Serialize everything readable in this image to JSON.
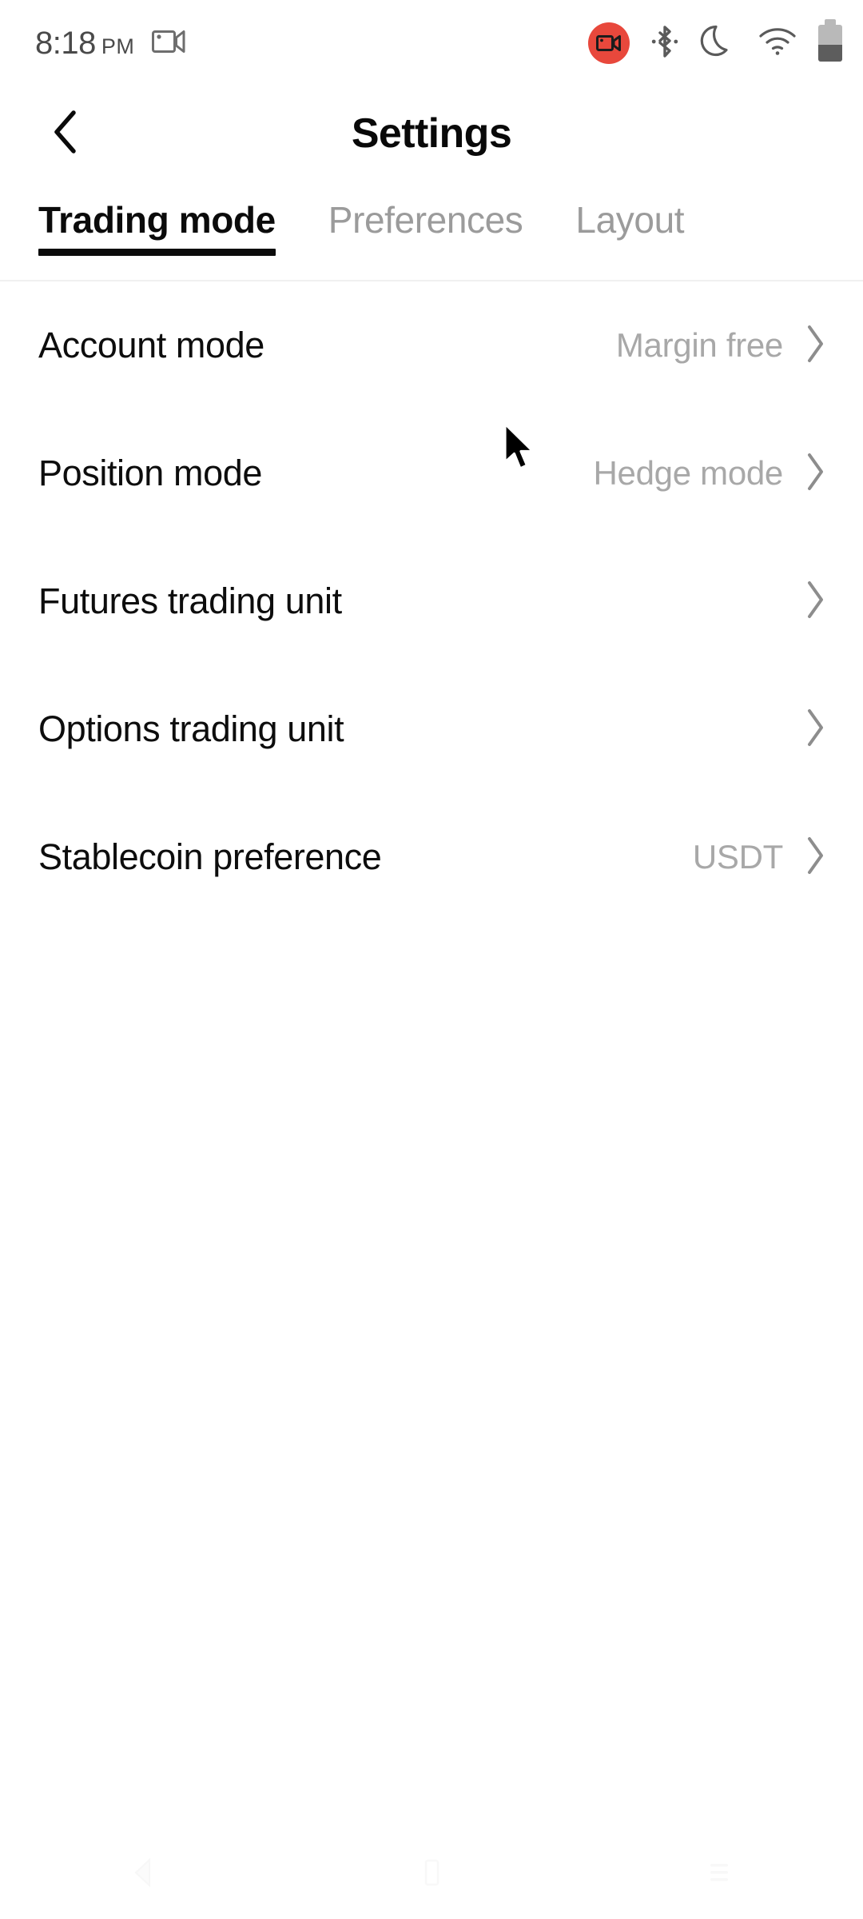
{
  "status_bar": {
    "time": "8:18",
    "meridiem": "PM",
    "icons": [
      "screen-record-camera-icon",
      "screen-record-badge-icon",
      "bluetooth-icon",
      "do-not-disturb-moon-icon",
      "wifi-icon",
      "battery-icon"
    ],
    "battery_level_percent": 45,
    "record_badge_color": "#e8483c"
  },
  "header": {
    "title": "Settings",
    "back_icon": "chevron-left-icon"
  },
  "tabs": [
    {
      "label": "Trading mode",
      "active": true
    },
    {
      "label": "Preferences",
      "active": false
    },
    {
      "label": "Layout",
      "active": false
    }
  ],
  "settings_rows": [
    {
      "label": "Account mode",
      "value": "Margin free"
    },
    {
      "label": "Position mode",
      "value": "Hedge mode"
    },
    {
      "label": "Futures trading unit",
      "value": ""
    },
    {
      "label": "Options trading unit",
      "value": ""
    },
    {
      "label": "Stablecoin preference",
      "value": "USDT"
    }
  ],
  "nav_bar": {
    "back_label": "back-triangle-icon",
    "home_label": "home-square-icon",
    "recents_label": "recents-lines-icon"
  },
  "colors": {
    "text_primary": "#0d0d0d",
    "text_muted": "#a8a8a8",
    "tab_inactive": "#9b9b9b",
    "accent": "#e8483c"
  }
}
